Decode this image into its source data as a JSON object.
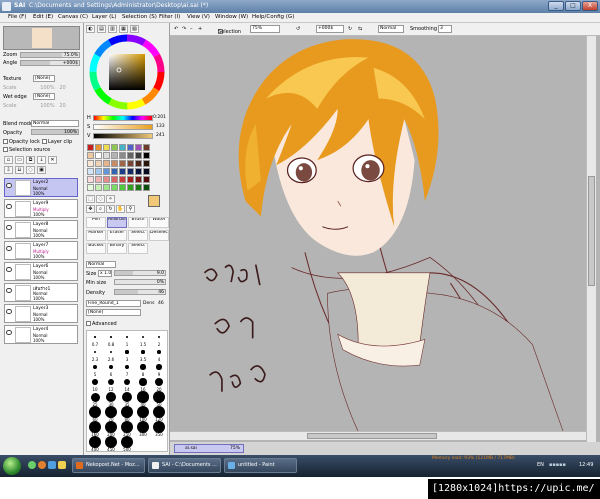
{
  "window": {
    "app_name": "SAI",
    "title": "C:\\Documents and Settings\\Administrator\\Desktop\\ai.sai (*)",
    "min": "_",
    "max": "□",
    "close": "X"
  },
  "menu": [
    "File (F)",
    "Edit (E)",
    "Canvas (C)",
    "Layer (L)",
    "Selection (S)",
    "Filter (I)",
    "View (V)",
    "Window (W)",
    "Help/Config (G)"
  ],
  "navigator": {
    "zoom_label": "Zoom",
    "zoom_value": "75.0%",
    "angle_label": "Angle",
    "angle_value": "+000$"
  },
  "texture": {
    "texture_label": "Texture",
    "texture_value": "[None]",
    "scale_label": "Scale",
    "scale_value": "100%",
    "texture_amount": "20",
    "wetedge_label": "Wet edge",
    "wetedge_value": "[None]",
    "wetedge_scale_label": "Scale",
    "wetedge_scale_value": "100%",
    "wetedge_amount": "20"
  },
  "blend": {
    "mode_label": "Blend mode",
    "mode_value": "Normal",
    "opacity_label": "Opacity",
    "opacity_value": "100%",
    "opacity_level": 1.0,
    "protect_label": "Opacity lock",
    "clip_label": "Layer clip",
    "source_label": "Selection source"
  },
  "layers": [
    {
      "name": "Layer2",
      "mode": "Normal",
      "opacity": "100%",
      "selected": true
    },
    {
      "name": "Layer9",
      "mode": "Multiply",
      "opacity": "100%",
      "selected": false
    },
    {
      "name": "Layer8",
      "mode": "Normal",
      "opacity": "100%",
      "selected": false
    },
    {
      "name": "Layer7",
      "mode": "Multiply",
      "opacity": "100%",
      "selected": false
    },
    {
      "name": "Layer6",
      "mode": "Normal",
      "opacity": "100%",
      "selected": false
    },
    {
      "name": "เส้นร่าง1",
      "mode": "Normal",
      "opacity": "100%",
      "selected": false
    },
    {
      "name": "Layer3",
      "mode": "Normal",
      "opacity": "100%",
      "selected": false
    },
    {
      "name": "Layer4",
      "mode": "Normal",
      "opacity": "100%",
      "selected": false
    }
  ],
  "color": {
    "h_label": "H",
    "h_value": "0:201",
    "s_label": "S",
    "s_value": "133",
    "v_label": "V",
    "v_value": "241",
    "primary": "#f0c878",
    "swatches": [
      "#c81e1e",
      "#e89632",
      "#f0dc50",
      "#8cc850",
      "#46b4c8",
      "#5064c8",
      "#a050b4",
      "#6e3c28",
      "#f0c8a0",
      "#ffffff",
      "#dcdcdc",
      "#b4b4b4",
      "#8c8c8c",
      "#646464",
      "#3c3c3c",
      "#000000",
      "#fae6d2",
      "#f0d2b4",
      "#e6b48c",
      "#c88c64",
      "#a06446",
      "#784632",
      "#502819",
      "#281409",
      "#d2e6fa",
      "#a0c8f0",
      "#6496dc",
      "#3264b4",
      "#1e3c8c",
      "#142864",
      "#0a1440",
      "#050a20",
      "#fadcdc",
      "#f0b4b4",
      "#e68c8c",
      "#dc6464",
      "#c83c3c",
      "#a01e1e",
      "#781414",
      "#500a0a",
      "#e6fadc",
      "#c8f0b4",
      "#a0e68c",
      "#78dc64",
      "#50c83c",
      "#32a01e",
      "#1e7814",
      "#0a500a"
    ]
  },
  "tools": [
    {
      "name": "Pen",
      "selected": false
    },
    {
      "name": "AirBrush",
      "selected": true
    },
    {
      "name": "Brush",
      "selected": false
    },
    {
      "name": "Water",
      "selected": false
    },
    {
      "name": "Marker",
      "selected": false
    },
    {
      "name": "Eraser",
      "selected": false
    },
    {
      "name": "Select",
      "selected": false
    },
    {
      "name": "Deselect",
      "selected": false
    },
    {
      "name": "Bucket",
      "selected": false
    },
    {
      "name": "Binary",
      "selected": false
    },
    {
      "name": "Select",
      "selected": false
    }
  ],
  "brush": {
    "mode_value": "Normal",
    "size_label": "Size",
    "size_mult": "x 1.0",
    "size_value": "9.0",
    "min_label": "Min size",
    "min_value": "0%",
    "density_label": "Density",
    "density_value": "46",
    "density_level": 0.46,
    "shape_value": "Fine_Round_1",
    "shape_dens_label": "Dens",
    "shape_dens_value": "46",
    "texture_value": "[None]",
    "advanced_label": "Advanced",
    "presets": [
      [
        "0.7",
        "0.8",
        "1",
        "1.5",
        "2"
      ],
      [
        "2.3",
        "2.6",
        "3",
        "3.5",
        "4"
      ],
      [
        "5",
        "6",
        "7",
        "8",
        "9"
      ],
      [
        "10",
        "12",
        "14",
        "16",
        "20"
      ],
      [
        "25",
        "30",
        "35",
        "40",
        "50"
      ],
      [
        "60",
        "70",
        "80",
        "100",
        "120"
      ],
      [
        "160",
        "200",
        "250",
        "300",
        "350"
      ],
      [
        "400",
        "450",
        "500"
      ]
    ]
  },
  "canvas_toolbar": {
    "selection_label": "Selection",
    "zoom": "75%",
    "angle": "+000$",
    "blend": "Normal",
    "smoothing_label": "Smoothing",
    "smoothing_value": "3"
  },
  "artwork": {
    "hair": "#e89a1e",
    "hair_light": "#f8c850",
    "skin": "#fae8dc",
    "line": "#5a2020",
    "background": "#b4b4b4",
    "thai_text": "ยุ่งๆ นะ ข่าวดี"
  },
  "document_tab": {
    "name": "ai.sai",
    "zoom": "75%"
  },
  "status": {
    "memory": "Memory load: 93% (121MB / 717MB)"
  },
  "taskbar": {
    "items": [
      {
        "label": "Nekopost.Net - Moz...",
        "icon_color": "#e06a1e"
      },
      {
        "label": "SAI - C:\\Documents ...",
        "icon_color": "#f0f0f0"
      },
      {
        "label": "untitled - Paint",
        "icon_color": "#6ab0e8"
      }
    ],
    "lang": "EN",
    "clock": "12:49"
  },
  "resolution_badge": "[1280x1024]https://upic.me/"
}
